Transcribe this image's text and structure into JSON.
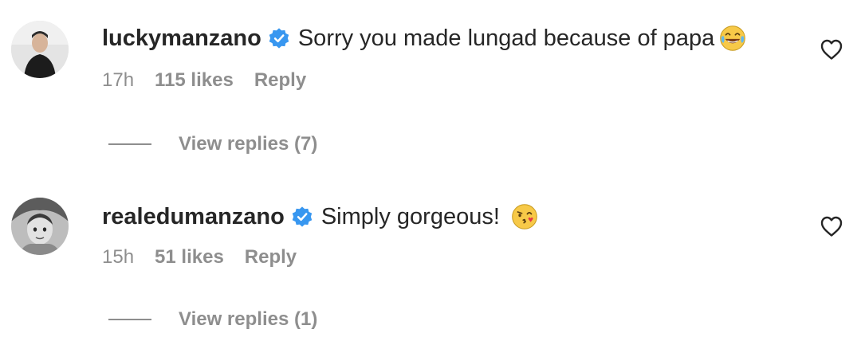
{
  "comments": [
    {
      "username": "luckymanzano",
      "text": "Sorry you made lungad because of papa",
      "emoji_icon": "face-with-tears-of-joy-emoji",
      "time": "17h",
      "likes": "115 likes",
      "reply_label": "Reply",
      "view_replies": "View replies (7)"
    },
    {
      "username": "realedumanzano",
      "text": "Simply gorgeous!",
      "emoji_icon": "face-blowing-kiss-emoji",
      "time": "15h",
      "likes": "51 likes",
      "reply_label": "Reply",
      "view_replies": "View replies (1)"
    }
  ],
  "colors": {
    "text": "#262626",
    "secondary": "#8e8e8e",
    "verified": "#3897f0"
  }
}
